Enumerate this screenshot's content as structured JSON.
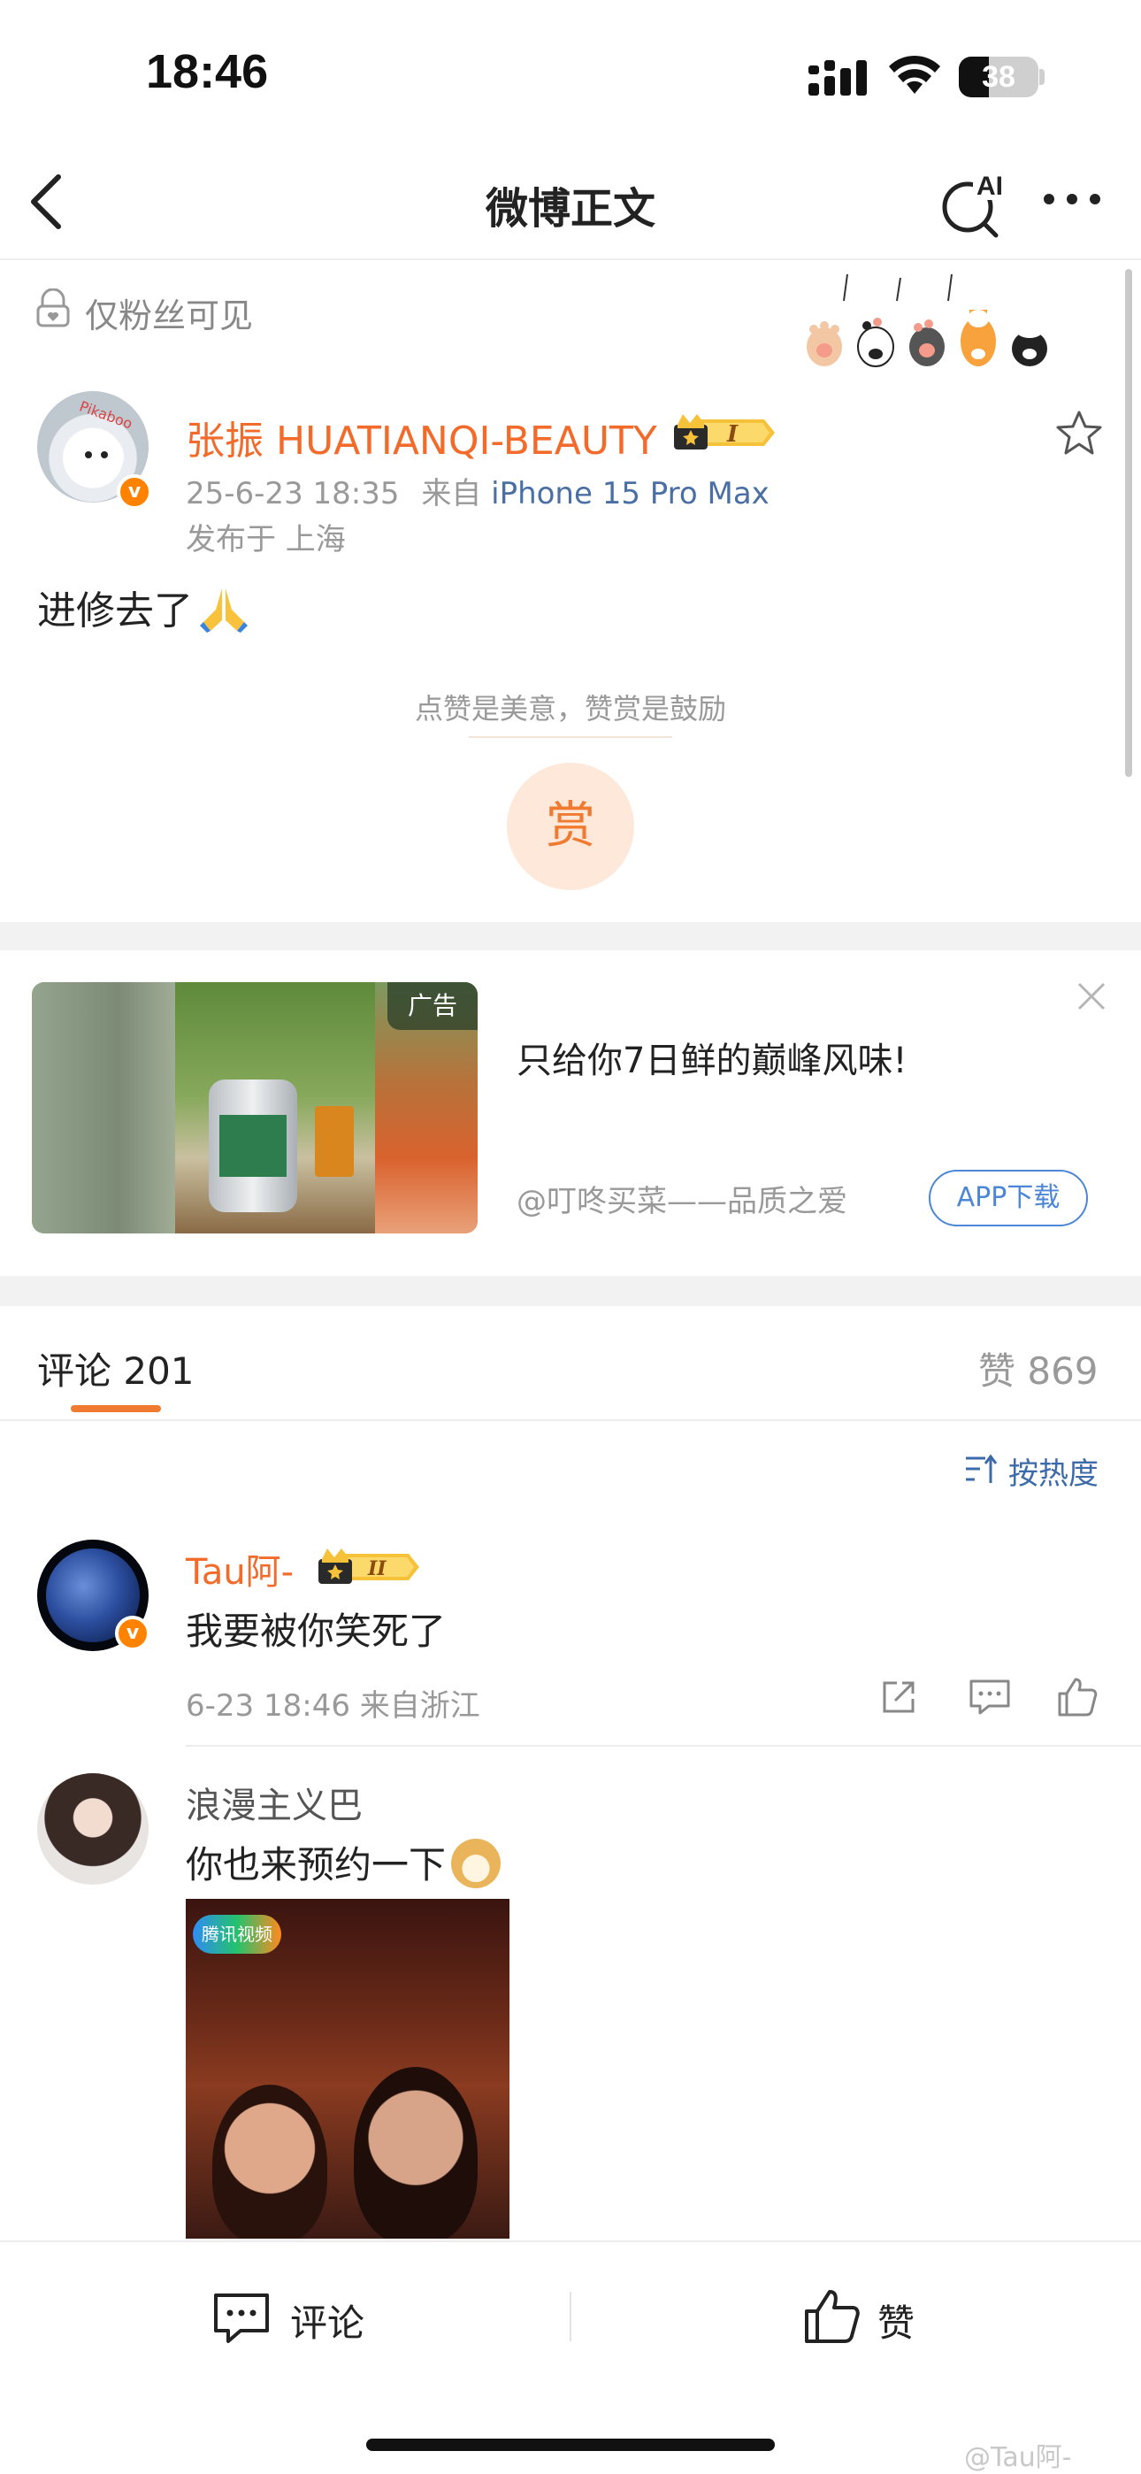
{
  "status_bar": {
    "time": "18:46",
    "battery": "38",
    "battery_level": 0.38
  },
  "nav": {
    "title": "微博正文",
    "ai_label": "AI"
  },
  "visibility": {
    "label": "仅粉丝可见"
  },
  "post": {
    "author": "张振 HUATIANQI-BEAUTY",
    "member_level": "I",
    "date": "25-6-23 18:35",
    "from_prefix": "来自",
    "device": "iPhone 15 Pro Max",
    "location": "发布于 上海",
    "text": "进修去了",
    "avatar_text": "Pikaboo"
  },
  "reward": {
    "hint": "点赞是美意，赞赏是鼓励",
    "button": "赏"
  },
  "ad": {
    "tag": "广告",
    "title": "只给你7日鲜的巅峰风味!",
    "source": "@叮咚买菜——品质之爱",
    "button": "APP下载"
  },
  "comments_header": {
    "label": "评论 201",
    "likes": "赞 869",
    "sort": "按热度"
  },
  "comments": [
    {
      "name": "Tau阿-",
      "member_level": "II",
      "text": "我要被你笑死了",
      "meta": "6-23 18:46 来自浙江"
    },
    {
      "name": "浪漫主义巴",
      "text": "你也来预约一下",
      "image_badge": "腾讯视频"
    }
  ],
  "bottom_bar": {
    "comment": "评论",
    "like": "赞"
  },
  "watermark": "@Tau阿-"
}
